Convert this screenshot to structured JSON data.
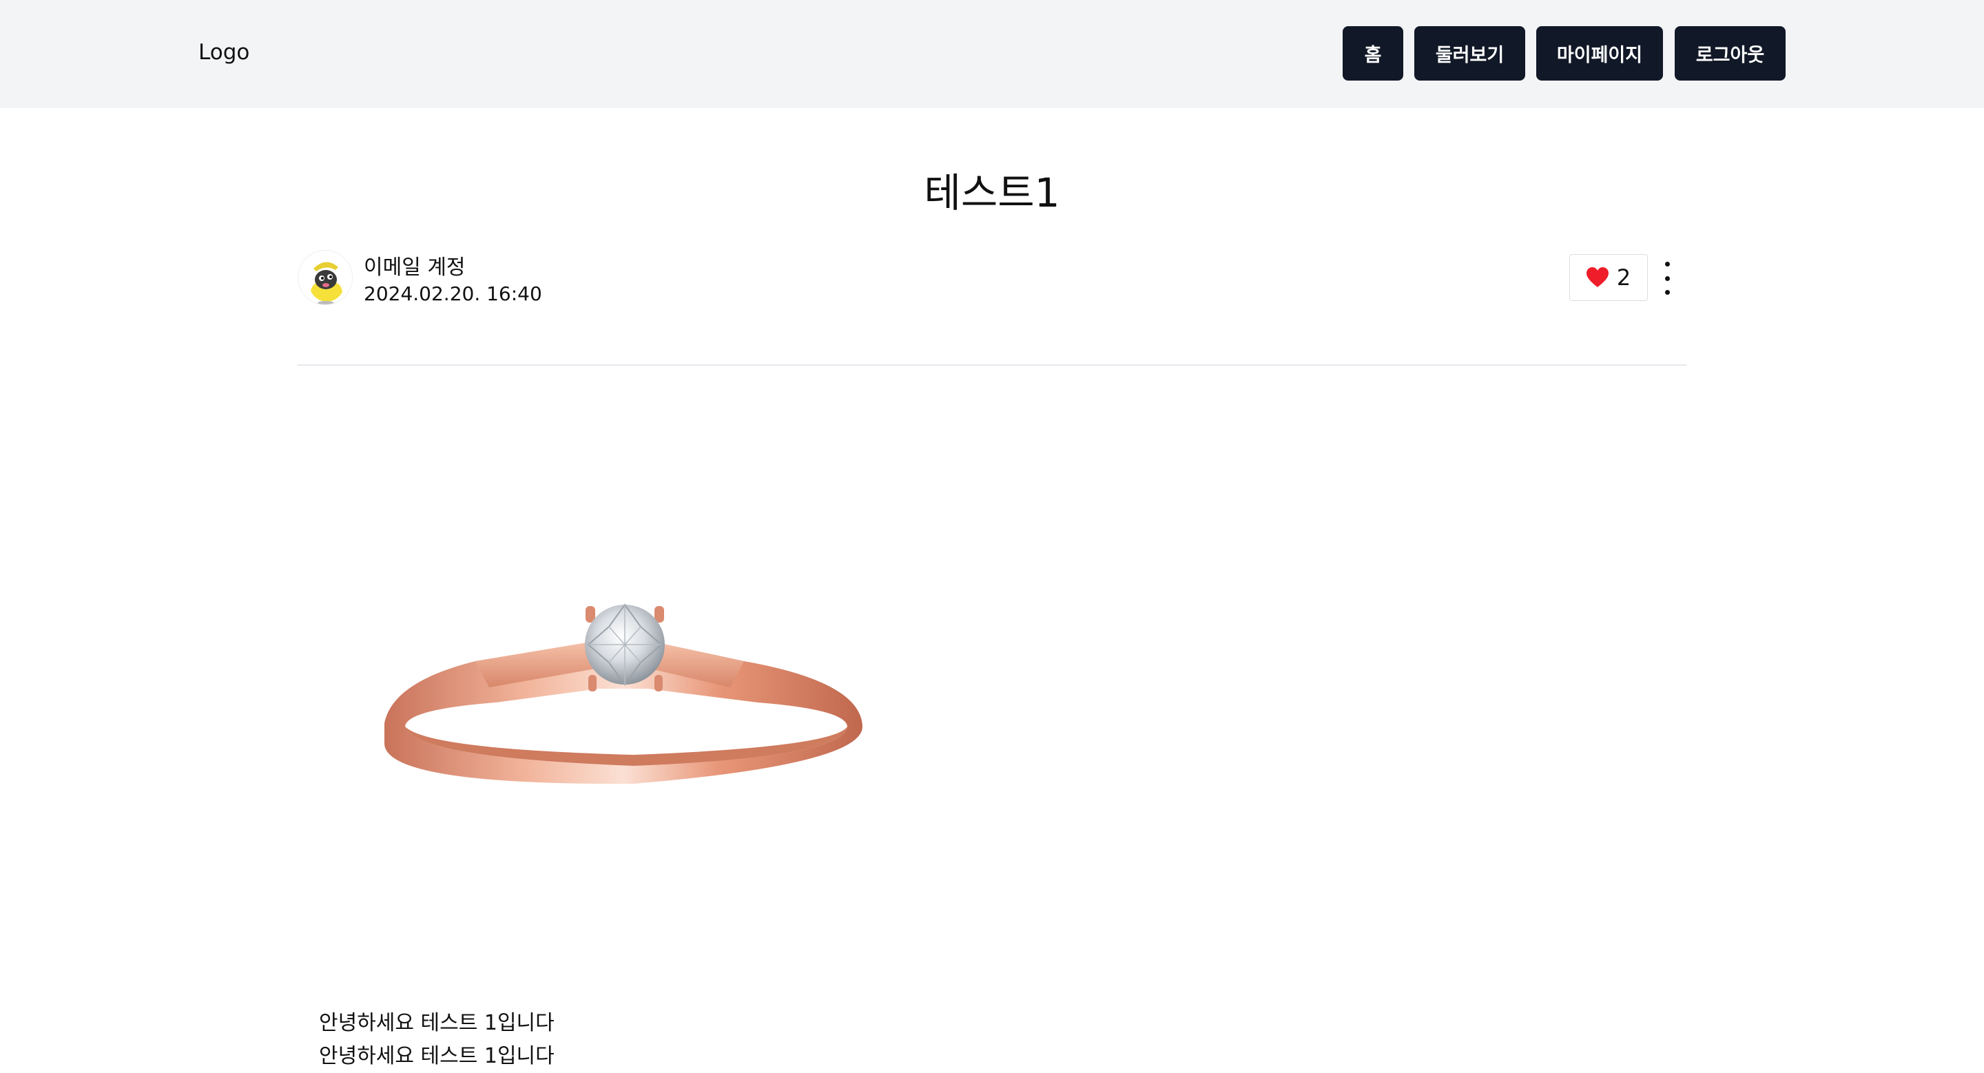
{
  "header": {
    "logo": "Logo",
    "nav": [
      "홈",
      "둘러보기",
      "마이페이지",
      "로그아웃"
    ]
  },
  "post": {
    "title": "테스트1",
    "author": "이메일 계정",
    "date": "2024.02.20. 16:40",
    "likes": "2",
    "body_lines": [
      "안녕하세요 테스트 1입니다",
      "안녕하세요 테스트 1입니다"
    ]
  },
  "colors": {
    "header_bg": "#f3f4f6",
    "button_bg": "#111827",
    "heart": "#ef1c2a",
    "ring": "#d98a6f"
  },
  "icons": [
    "avatar-mascot-icon",
    "heart-icon",
    "more-vertical-icon"
  ]
}
